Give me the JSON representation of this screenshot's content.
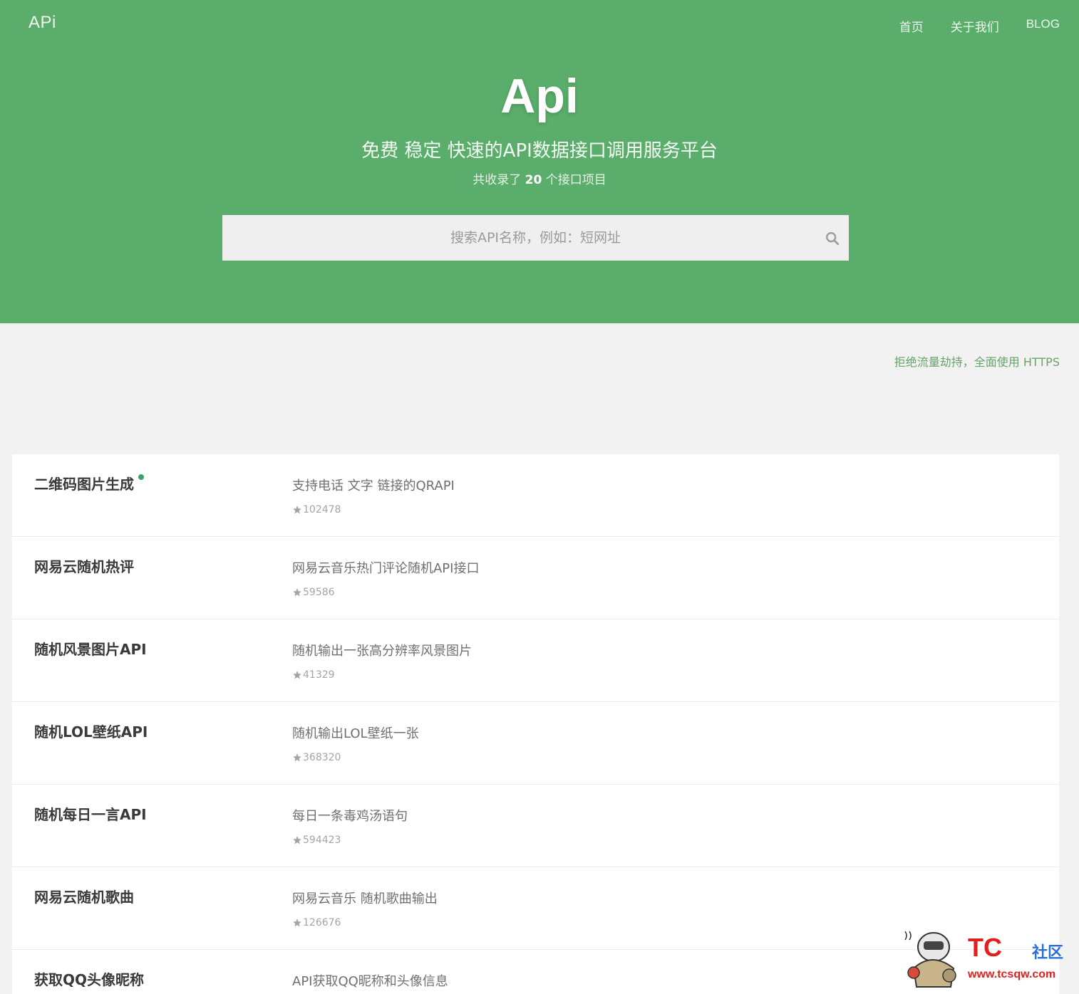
{
  "header": {
    "logo": "APi",
    "nav": [
      "首页",
      "关于我们",
      "BLOG"
    ]
  },
  "hero": {
    "title": "Api",
    "subtitle": "免费 稳定 快速的API数据接口调用服务平台",
    "count_prefix": "共收录了",
    "count": "20",
    "count_suffix": "个接口项目"
  },
  "search": {
    "placeholder": "搜索API名称，例如：短网址",
    "icon": "search-icon"
  },
  "notice": "拒绝流量劫持，全面使用 HTTPS",
  "apis": [
    {
      "name": "二维码图片生成",
      "desc": "支持电话 文字 链接的QRAPI",
      "stars": "102478",
      "dot": true
    },
    {
      "name": "网易云随机热评",
      "desc": "网易云音乐热门评论随机API接口",
      "stars": "59586",
      "dot": false
    },
    {
      "name": "随机风景图片API",
      "desc": "随机输出一张高分辨率风景图片",
      "stars": "41329",
      "dot": false
    },
    {
      "name": "随机LOL壁纸API",
      "desc": "随机输出LOL壁纸一张",
      "stars": "368320",
      "dot": false
    },
    {
      "name": "随机每日一言API",
      "desc": "每日一条毒鸡汤语句",
      "stars": "594423",
      "dot": false
    },
    {
      "name": "网易云随机歌曲",
      "desc": "网易云音乐 随机歌曲输出",
      "stars": "126676",
      "dot": false
    },
    {
      "name": "获取QQ头像昵称",
      "desc": "API获取QQ昵称和头像信息",
      "stars": "",
      "dot": false
    }
  ],
  "watermark": {
    "brand": "TC",
    "community": "社区",
    "url": "www.tcsqw.com"
  },
  "colors": {
    "hero_bg": "#5aad6a",
    "notice": "#6aa36b",
    "dot": "#3ca06e"
  }
}
